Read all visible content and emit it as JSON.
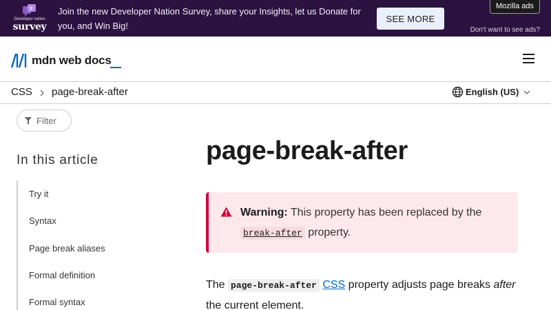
{
  "banner": {
    "logo_small": "Developer nation",
    "logo_big": "survey",
    "text": "Join the new Developer Nation Survey, share your Insights, let us Donate for you, and Win Big!",
    "cta_label": "SEE MORE",
    "ads_label": "Mozilla ads",
    "dont_want": "Don't want to see ads?"
  },
  "header": {
    "logo_text": "mdn web docs",
    "menu_icon": "hamburger-menu-icon"
  },
  "breadcrumb": {
    "items": [
      "CSS",
      "page-break-after"
    ],
    "language": "English (US)"
  },
  "sidebar": {
    "filter_label": "Filter",
    "toc_title": "In this article",
    "toc_items": [
      "Try it",
      "Syntax",
      "Page break aliases",
      "Formal definition",
      "Formal syntax"
    ]
  },
  "main": {
    "title": "page-break-after",
    "warning": {
      "label": "Warning:",
      "text_before": "This property has been replaced by the",
      "code": "break-after",
      "text_after": "property."
    },
    "intro": {
      "prefix": "The",
      "code": "page-break-after",
      "link": "CSS",
      "text1": "property adjusts page breaks",
      "em": "after",
      "text2": "the current element."
    }
  },
  "colors": {
    "banner_bg": "#2c1240",
    "link": "#0069c2",
    "warning_border": "#d30038",
    "warning_bg": "#fde8eb"
  }
}
